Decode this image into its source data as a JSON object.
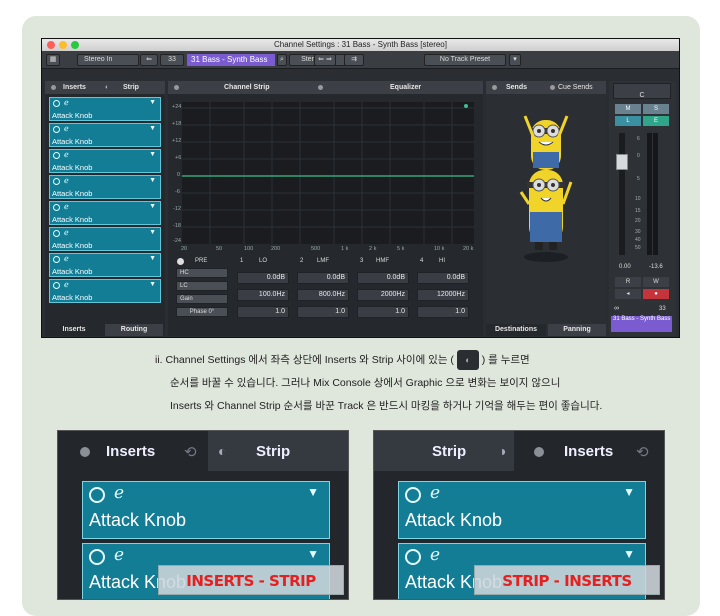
{
  "window": {
    "title": "Channel Settings : 31 Bass - Synth Bass [stereo]",
    "toolbar": {
      "stereo_in": "Stereo In",
      "channel_num": "33",
      "track_name": "31 Bass - Synth Bass",
      "stereo_out": "Stereo Out",
      "preset": "No Track Preset"
    }
  },
  "left_panel": {
    "tabs": [
      "Inserts",
      "Strip"
    ],
    "slots": [
      "Attack Knob",
      "Attack Knob",
      "Attack Knob",
      "Attack Knob",
      "Attack Knob",
      "Attack Knob",
      "Attack Knob",
      "Attack Knob"
    ],
    "bottom_tabs": [
      "Inserts",
      "Routing"
    ]
  },
  "center_panel": {
    "tabs": [
      "Channel Strip",
      "Equalizer"
    ],
    "y_ticks": [
      "+24",
      "+18",
      "+12",
      "+6",
      "0",
      "-6",
      "-12",
      "-18",
      "-24"
    ],
    "x_ticks": [
      "20",
      "50",
      "100",
      "200",
      "500",
      "1 k",
      "2 k",
      "5 k",
      "10 k",
      "20 k"
    ],
    "pre": "PRE",
    "bands": [
      {
        "num": "1",
        "name": "LO",
        "gain": "0.0dB",
        "freq": "100.0Hz",
        "q": "1.0"
      },
      {
        "num": "2",
        "name": "LMF",
        "gain": "0.0dB",
        "freq": "800.0Hz",
        "q": "1.0"
      },
      {
        "num": "3",
        "name": "HMF",
        "gain": "0.0dB",
        "freq": "2000Hz",
        "q": "1.0"
      },
      {
        "num": "4",
        "name": "HI",
        "gain": "0.0dB",
        "freq": "12000Hz",
        "q": "1.0"
      }
    ],
    "left_buttons": [
      "HC",
      "LC",
      "Gain",
      "Phase 0°"
    ]
  },
  "right_panel": {
    "tabs": [
      "Sends",
      "Cue Sends"
    ],
    "bottom_tabs": [
      "Destinations",
      "Panning"
    ]
  },
  "meter": {
    "pan": "C",
    "buttons": [
      "M",
      "S",
      "L",
      "E",
      "R",
      "W"
    ],
    "scale": [
      "6",
      "0",
      "5",
      "10",
      "15",
      "20",
      "30",
      "40",
      "50"
    ],
    "fader_val": "0.00",
    "peak_val": "-13.6",
    "channel_num": "33",
    "channel_name": "31 Bass - Synth Bass"
  },
  "description": {
    "line1_a": "ii. Channel Settings 에서 좌측 상단에 Inserts 와 Strip 사이에 있는 (",
    "line1_b": ") 를 누르면",
    "line2": "순서를 바꿀 수 있습니다. 그러나 Mix Console 상에서 Graphic 으로 변화는 보이지 않으니",
    "line3": "Inserts 와 Channel Strip 순서를 바꾼 Track 은 반드시 마킹을 하거나 기억을 해두는 편이 좋습니다."
  },
  "insets": [
    {
      "tab_left": "Inserts",
      "tab_right": "Strip",
      "slot1": "Attack Knob",
      "slot2": "Attack Knob",
      "stamp": "INSERTS - STRIP ORDER"
    },
    {
      "tab_left": "Strip",
      "tab_right": "Inserts",
      "slot1": "Attack Knob",
      "slot2": "Attack Knob",
      "stamp": "STRIP - INSERTS ORDER"
    }
  ],
  "colors": {
    "accent": "#137d96",
    "track_purple": "#7a5bd0",
    "stamp_red": "#e52020"
  }
}
